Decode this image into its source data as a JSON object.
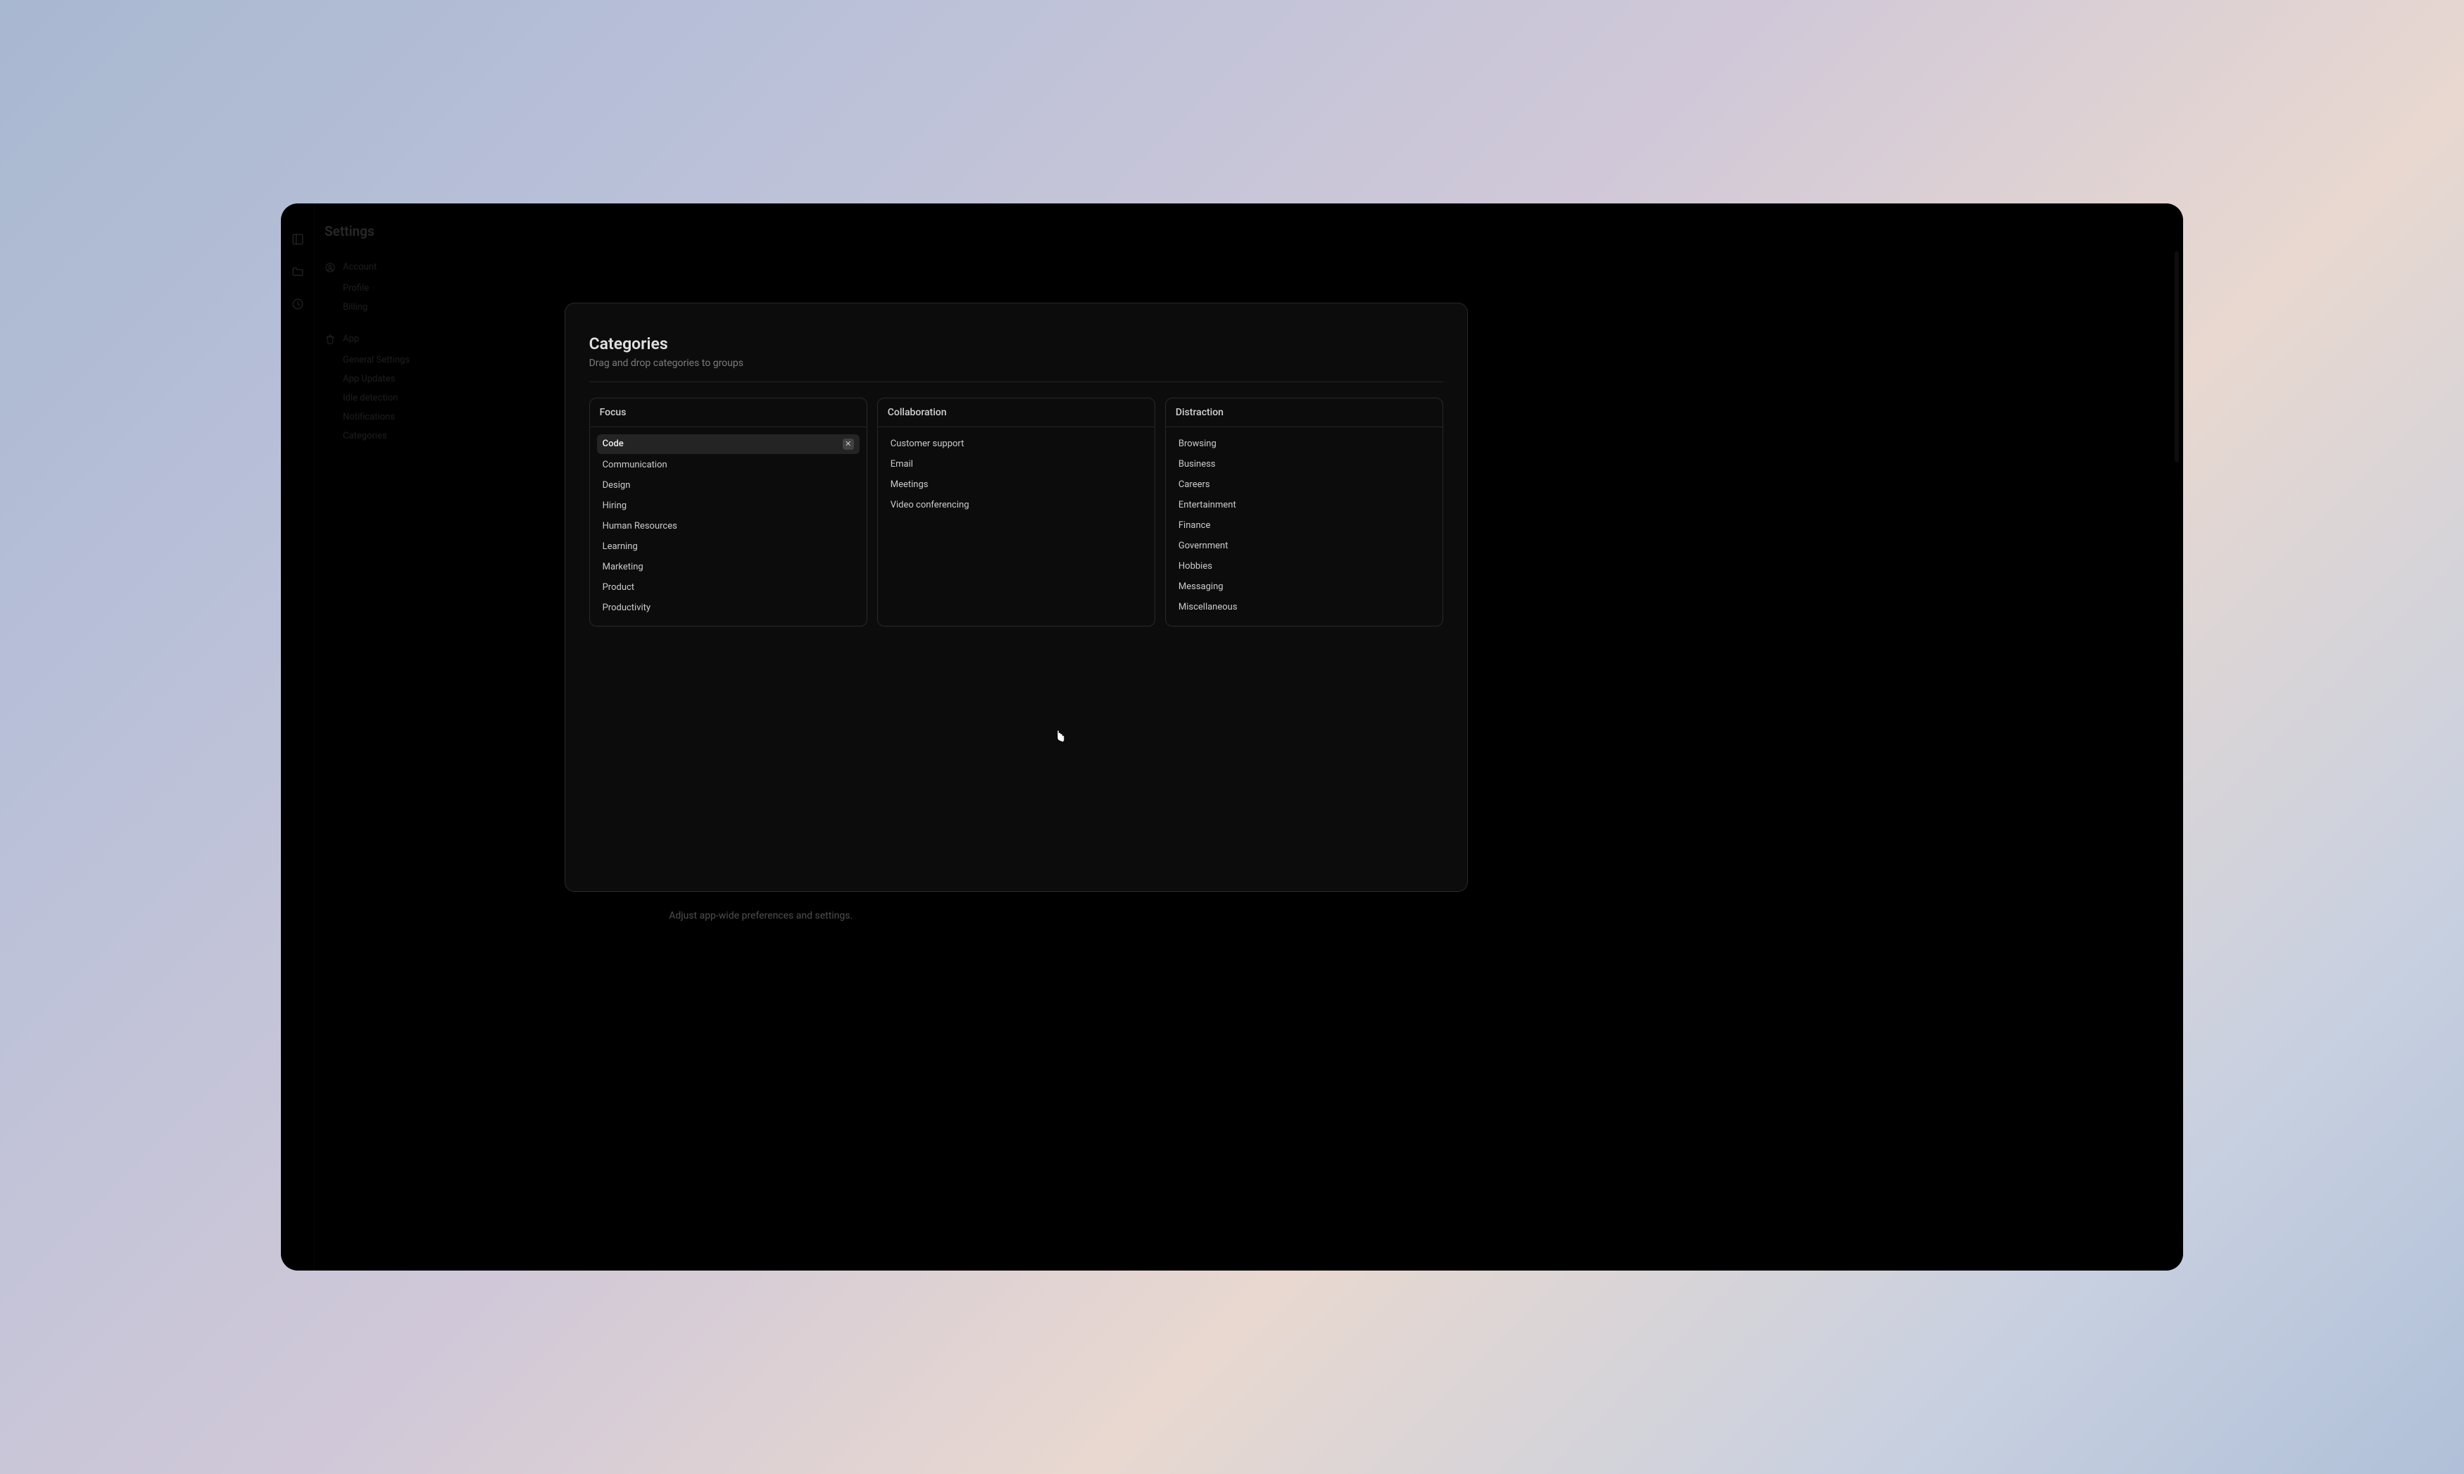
{
  "page": {
    "title": "Settings"
  },
  "nav": {
    "groups": [
      {
        "label": "Account",
        "icon": "user-circle-icon",
        "items": [
          "Profile",
          "Billing"
        ]
      },
      {
        "label": "App",
        "icon": "trash-icon",
        "items": [
          "General Settings",
          "App Updates",
          "Idle detection",
          "Notifications",
          "Categories"
        ]
      }
    ]
  },
  "modal": {
    "title": "Categories",
    "subtitle": "Drag and drop categories to groups",
    "under_text": "Adjust app-wide preferences and settings.",
    "groups": [
      {
        "name": "Focus",
        "items": [
          "Code",
          "Communication",
          "Design",
          "Hiring",
          "Human Resources",
          "Learning",
          "Marketing",
          "Product",
          "Productivity"
        ]
      },
      {
        "name": "Collaboration",
        "items": [
          "Customer support",
          "Email",
          "Meetings",
          "Video conferencing"
        ]
      },
      {
        "name": "Distraction",
        "items": [
          "Browsing",
          "Business",
          "Careers",
          "Entertainment",
          "Finance",
          "Government",
          "Hobbies",
          "Messaging",
          "Miscellaneous"
        ]
      }
    ],
    "hovered_item": "Code"
  }
}
